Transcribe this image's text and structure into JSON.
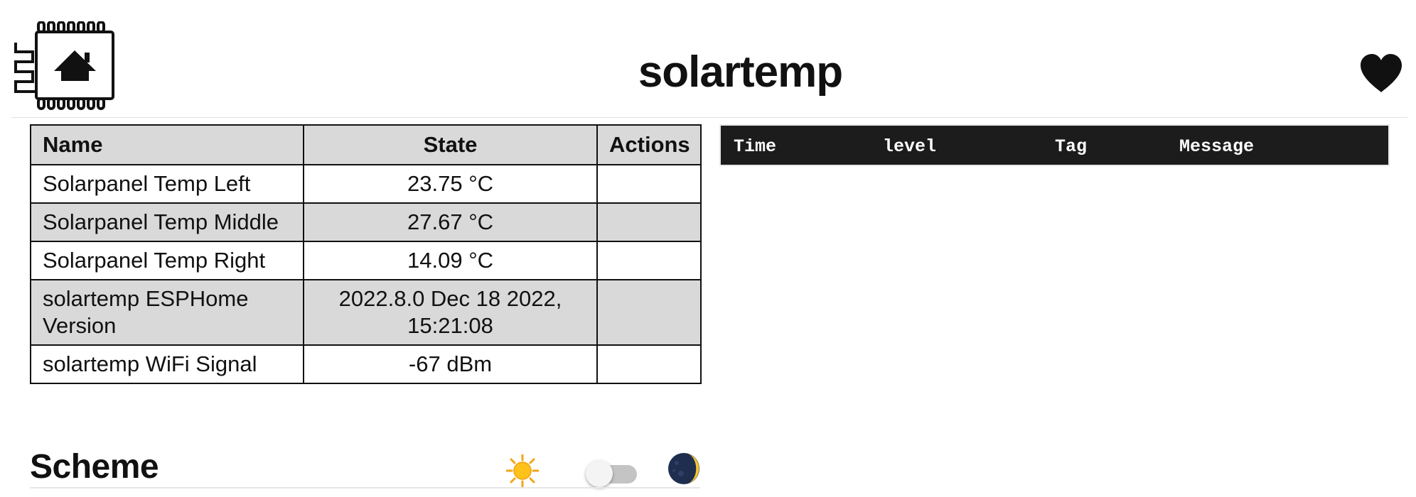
{
  "header": {
    "title": "solartemp",
    "logo_icon": "esp-chip-home-icon",
    "support_icon": "heart-icon"
  },
  "entities": {
    "columns": [
      "Name",
      "State",
      "Actions"
    ],
    "rows": [
      {
        "name": "Solarpanel Temp Left",
        "state": "23.75 °C",
        "actions": ""
      },
      {
        "name": "Solarpanel Temp Middle",
        "state": "27.67 °C",
        "actions": ""
      },
      {
        "name": "Solarpanel Temp Right",
        "state": "14.09 °C",
        "actions": ""
      },
      {
        "name": "solartemp ESPHome Version",
        "state": "2022.8.0 Dec 18 2022, 15:21:08",
        "actions": ""
      },
      {
        "name": "solartemp WiFi Signal",
        "state": "-67 dBm",
        "actions": ""
      }
    ]
  },
  "log": {
    "columns": [
      "Time",
      "level",
      "Tag",
      "Message"
    ]
  },
  "scheme": {
    "title": "Scheme",
    "light_icon": "sun-icon",
    "dark_icon": "moon-icon",
    "dark_mode_enabled": false
  },
  "colors": {
    "table_header_bg": "#d9d9d9",
    "log_bg": "#1c1c1c",
    "toggle_track": "#c4c4c4"
  }
}
